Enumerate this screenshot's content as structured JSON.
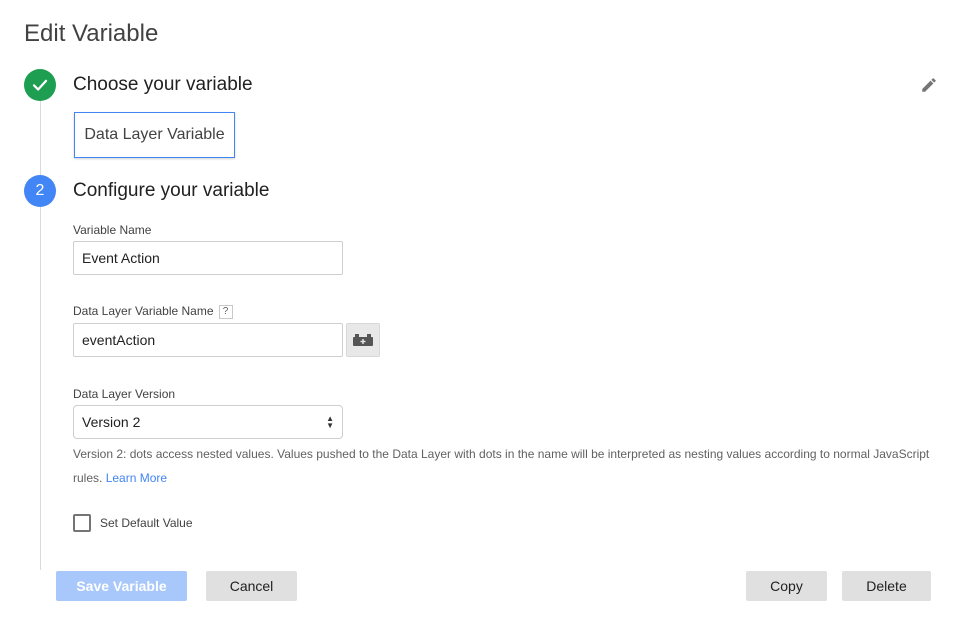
{
  "page": {
    "title": "Edit Variable"
  },
  "step1": {
    "title": "Choose your variable",
    "selected_type": "Data Layer Variable",
    "icon": "check-icon",
    "edit_icon": "pencil-icon"
  },
  "step2": {
    "number": "2",
    "title": "Configure your variable"
  },
  "fields": {
    "variable_name": {
      "label": "Variable Name",
      "value": "Event Action"
    },
    "dl_variable_name": {
      "label": "Data Layer Variable Name",
      "help": "?",
      "value": "eventAction",
      "picker_icon": "variable-brick-icon"
    },
    "dl_version": {
      "label": "Data Layer Version",
      "selected": "Version 2",
      "help_text": "Version 2: dots access nested values. Values pushed to the Data Layer with dots in the name will be interpreted as nesting values according to normal JavaScript rules.",
      "learn_more": "Learn More"
    },
    "default_value": {
      "label": "Set Default Value",
      "checked": false
    }
  },
  "buttons": {
    "save": "Save Variable",
    "cancel": "Cancel",
    "copy": "Copy",
    "delete": "Delete"
  },
  "colors": {
    "done_green": "#1e9e50",
    "step_blue": "#4285f4",
    "save_disabled": "#a8c7fa",
    "link": "#4285f4"
  }
}
